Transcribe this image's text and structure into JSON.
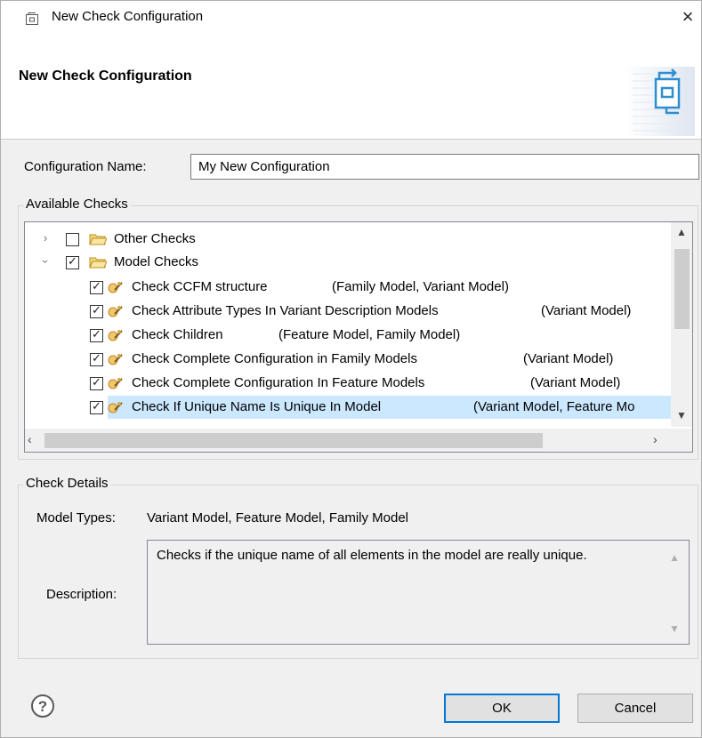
{
  "window": {
    "title": "New Check Configuration",
    "close_glyph": "×"
  },
  "banner": {
    "heading": "New Check Configuration"
  },
  "config": {
    "label": "Configuration Name:",
    "value": "My New Configuration"
  },
  "available": {
    "title": "Available Checks",
    "groups": [
      {
        "label": "Other Checks",
        "checked": false,
        "expanded": false
      },
      {
        "label": "Model Checks",
        "checked": true,
        "expanded": true
      }
    ],
    "items": [
      {
        "name": "Check CCFM structure",
        "types": "(Family Model, Variant Model)",
        "checked": true
      },
      {
        "name": "Check Attribute Types In Variant Description Models",
        "types": "(Variant Model)",
        "checked": true
      },
      {
        "name": "Check Children",
        "types": "(Feature Model, Family Model)",
        "checked": true
      },
      {
        "name": "Check Complete Configuration in Family Models",
        "types": "(Variant Model)",
        "checked": true
      },
      {
        "name": "Check Complete Configuration In Feature Models",
        "types": "(Variant Model)",
        "checked": true
      },
      {
        "name": "Check If Unique Name Is Unique In Model",
        "types": "(Variant Model, Feature Mo",
        "checked": true,
        "selected": true
      }
    ]
  },
  "details": {
    "title": "Check Details",
    "model_types_label": "Model Types:",
    "model_types_value": "Variant Model, Feature Model, Family Model",
    "description_label": "Description:",
    "description_value": "Checks if the unique name of all elements in the model are really unique."
  },
  "buttons": {
    "ok": "OK",
    "cancel": "Cancel"
  },
  "icons": {
    "app": "check-config-icon",
    "wizard": "wizard-banner-icon",
    "help": "help-icon",
    "folder": "folder-icon",
    "check": "check-rule-icon"
  },
  "colors": {
    "selection": "#cce8ff",
    "default_button_border": "#0078d7",
    "background": "#f0f0f0"
  }
}
